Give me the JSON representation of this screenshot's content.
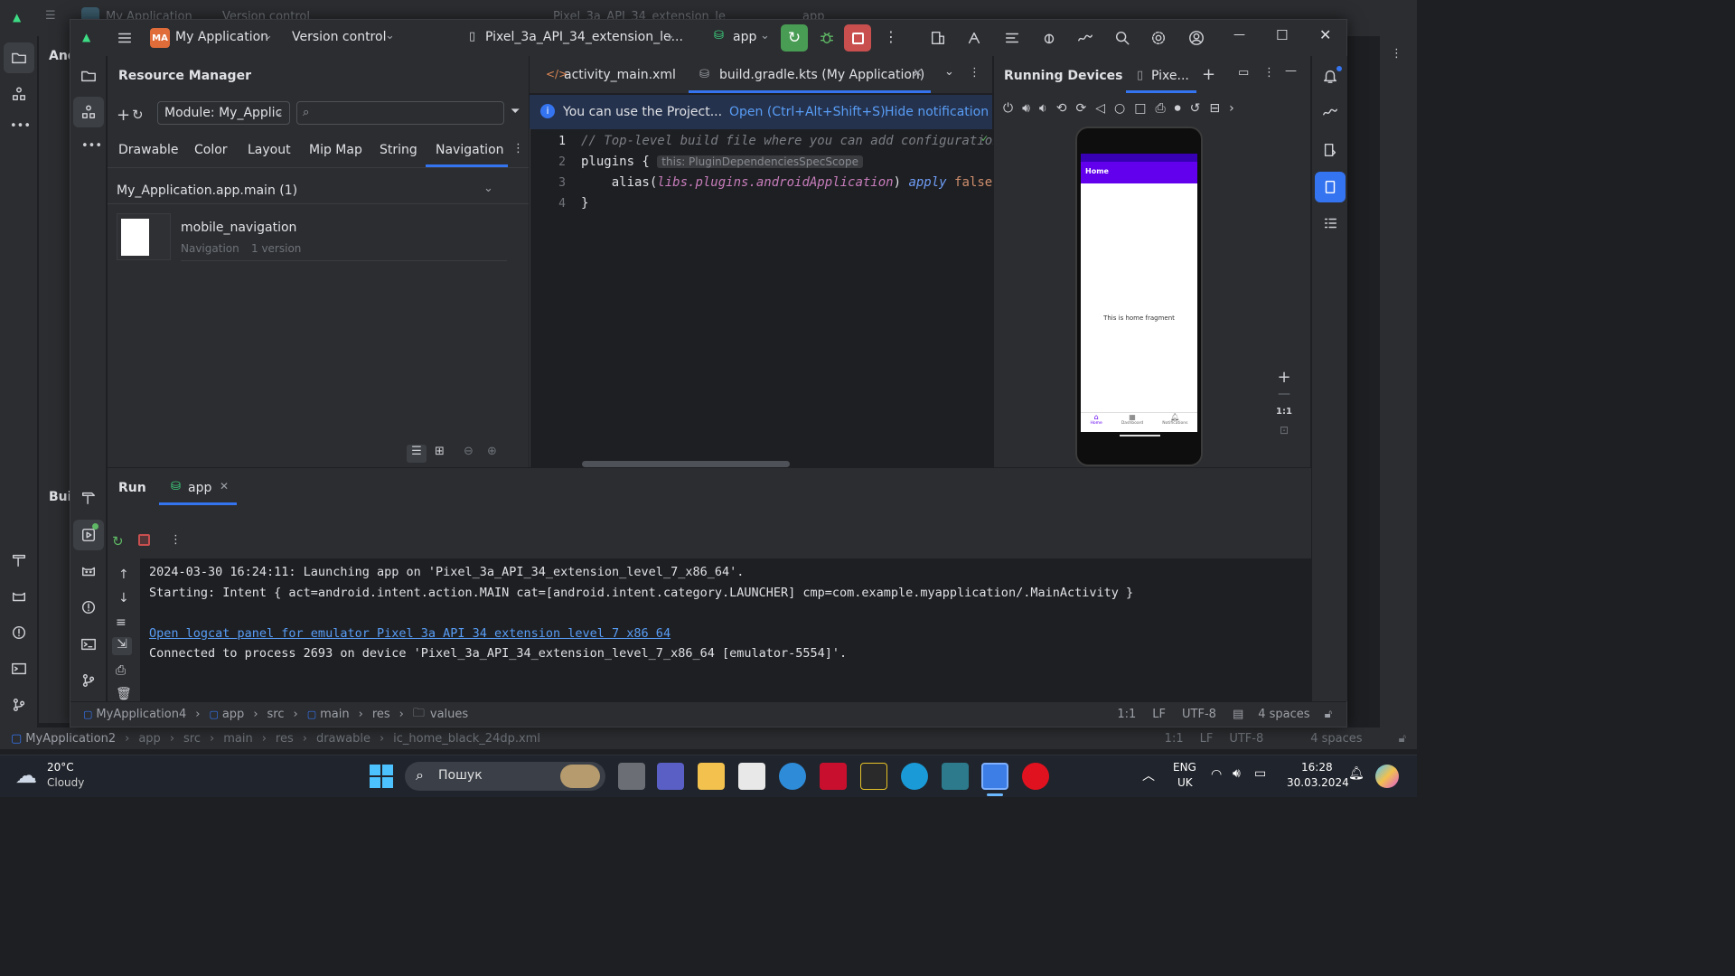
{
  "bg_window": {
    "app_name": "My Application",
    "vcs": "Version control",
    "device": "Pixel_3a_API_34_extension_le",
    "config": "app",
    "left_panel_title": "And",
    "build_label": "Bui",
    "breadcrumb": [
      "MyApplication2",
      "app",
      "src",
      "main",
      "res",
      "drawable",
      "ic_home_black_24dp.xml"
    ],
    "status_right": {
      "pos": "1:1",
      "lf": "LF",
      "enc": "UTF-8",
      "indent": "4 spaces"
    }
  },
  "title_bar": {
    "project_badge": "MA",
    "project_name": "My Application",
    "vcs": "Version control",
    "device": "Pixel_3a_API_34_extension_le...",
    "run_config": "app"
  },
  "resource_manager": {
    "title": "Resource Manager",
    "module": "Module: My_Applic",
    "search_placeholder": "",
    "tabs": [
      "Drawable",
      "Color",
      "Layout",
      "Mip Map",
      "String",
      "Navigation"
    ],
    "active_tab": "Navigation",
    "group": "My_Application.app.main (1)",
    "item": {
      "name": "mobile_navigation",
      "type": "Navigation",
      "versions": "1 version"
    }
  },
  "editor": {
    "tabs": [
      {
        "label": "activity_main.xml"
      },
      {
        "label": "build.gradle.kts (My Application)"
      }
    ],
    "notification": {
      "text": "You can use the Project...",
      "open": "Open (Ctrl+Alt+Shift+S)",
      "hide": "Hide notification"
    },
    "lines": [
      {
        "n": "1",
        "t": "// Top-level build file where you can add configuration"
      },
      {
        "n": "2",
        "a": "plugins {",
        "hint": "this: PluginDependenciesSpecScope"
      },
      {
        "n": "3",
        "p1": "    alias(",
        "p2": "libs.plugins.androidApplication",
        "p3": ") ",
        "p4": "apply",
        "p5": " false"
      },
      {
        "n": "4",
        "t": "}"
      }
    ]
  },
  "devices": {
    "title": "Running Devices",
    "tab": "Pixe...",
    "phone": {
      "app_title": "Home",
      "fragment_text": "This is home fragment",
      "nav": [
        "Home",
        "Dashboard",
        "Notifications"
      ]
    },
    "zoom_one": "1:1"
  },
  "run": {
    "title": "Run",
    "tab": "app",
    "log": [
      "2024-03-30 16:24:11: Launching app on 'Pixel_3a_API_34_extension_level_7_x86_64'.",
      "Starting: Intent { act=android.intent.action.MAIN cat=[android.intent.category.LAUNCHER] cmp=com.example.myapplication/.MainActivity }",
      "",
      "Open logcat panel for emulator Pixel 3a API 34 extension level 7 x86 64",
      "Connected to process 2693 on device 'Pixel_3a_API_34_extension_level_7_x86_64 [emulator-5554]'."
    ]
  },
  "status": {
    "breadcrumb": [
      "MyApplication4",
      "app",
      "src",
      "main",
      "res",
      "values"
    ],
    "pos": "1:1",
    "lf": "LF",
    "enc": "UTF-8",
    "indent": "4 spaces"
  },
  "taskbar": {
    "temp": "20°C",
    "weather": "Cloudy",
    "search": "Пошук",
    "lang1": "ENG",
    "lang2": "UK",
    "time": "16:28",
    "date": "30.03.2024"
  },
  "colors": {
    "accent": "#3574f0",
    "run_green": "#499c54",
    "stop_red": "#c94f4f",
    "badge_orange": "#e06c3a",
    "phone_purple": "#6200ee"
  }
}
